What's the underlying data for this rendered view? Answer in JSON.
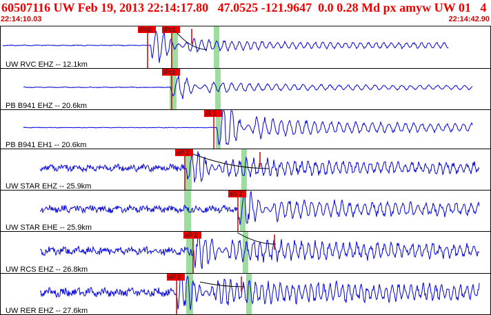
{
  "header": {
    "title": "60507116 UW Feb 19, 2013 22:14:17.80   47.0525 -121.9647  0.0 0.28 Md px amyw UW 01   4",
    "start_time": "22:14:10.03",
    "end_time": "22:14:42.90"
  },
  "colors": {
    "title": "#ee0000",
    "time": "#cc0000",
    "trace": "#0000dd",
    "pick_box": "#ee0000",
    "pick_line": "#cc0000",
    "window": "#9fdc9f",
    "divider": "#000000"
  },
  "traces": [
    {
      "label": "UW RVC EHZ -- 12.1km",
      "picks": [
        "iPd0",
        "iPc1"
      ]
    },
    {
      "label": "PB B941 EHZ -- 20.6km",
      "picks": [
        "iPc1"
      ]
    },
    {
      "label": "PB B941 EH1 -- 20.6km",
      "picks": [
        "iS 1"
      ]
    },
    {
      "label": "UW STAR EHZ -- 25.9km",
      "picks": [
        "eP 2"
      ]
    },
    {
      "label": "UW STAR EHE -- 25.9km",
      "picks": [
        "eS 2"
      ]
    },
    {
      "label": "UW RCS EHZ -- 26.8km",
      "picks": [
        "eP 2"
      ]
    },
    {
      "label": "UW RER EHZ -- 27.6km",
      "picks": [
        "eP 2"
      ]
    }
  ]
}
